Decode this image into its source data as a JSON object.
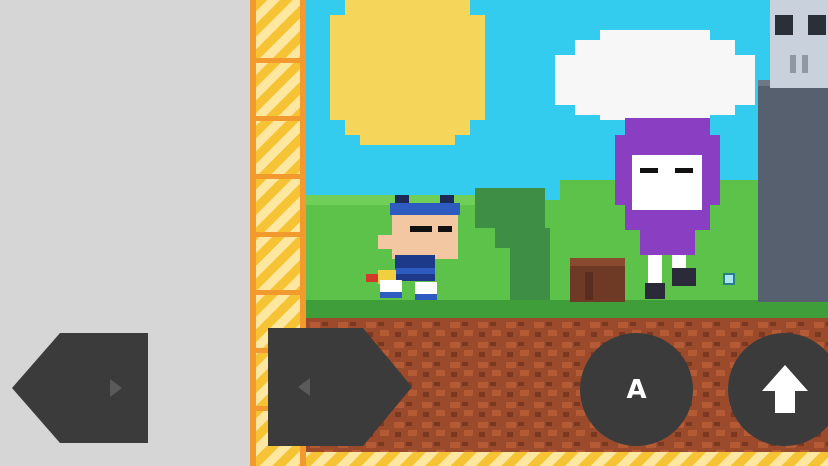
{
  "game": {
    "scene": "pixel-platformer-level",
    "player": "headband-kid",
    "npcs": [
      "purple-hooded-girl",
      "skull-stone-tower"
    ],
    "props": [
      "sun",
      "cloud",
      "hill",
      "tree-stump",
      "small-gem"
    ]
  },
  "controls": {
    "left": {
      "icon": "triangle-left-icon"
    },
    "right": {
      "icon": "triangle-right-icon"
    },
    "action": {
      "label": "A"
    },
    "jump": {
      "icon": "arrow-up-icon"
    }
  },
  "colors": {
    "sky": "#33ccee",
    "sun": "#f6d65a",
    "cloud": "#f7f7f7",
    "grass": "#5cc24a",
    "grass_top": "#3f9e3a",
    "dirt": "#9b4b2b",
    "dirt_dark": "#7a3820",
    "frame_yellow": "#f6c335",
    "frame_orange": "#f29a2e",
    "backdrop": "#d6d6d6",
    "control": "#3b3b3b",
    "tower": "#56606e",
    "purple": "#8a3fc2"
  }
}
